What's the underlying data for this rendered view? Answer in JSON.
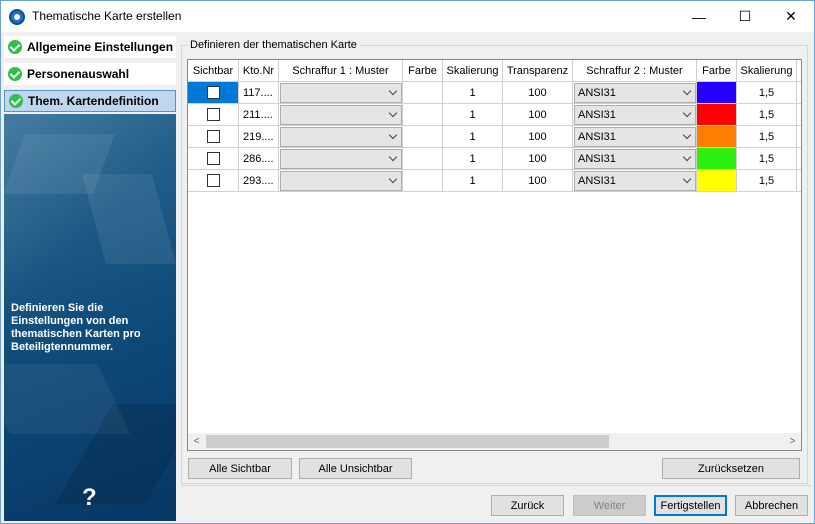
{
  "window": {
    "title": "Thematische Karte erstellen",
    "minimize_glyph": "—",
    "maximize_glyph": "☐",
    "close_glyph": "✕"
  },
  "sidebar": {
    "steps": [
      {
        "label": "Allgemeine Einstellungen",
        "icon": "check-icon",
        "active": false
      },
      {
        "label": "Personenauswahl",
        "icon": "check-icon",
        "active": false
      },
      {
        "label": "Them. Kartendefinition",
        "icon": "check-icon",
        "active": true
      }
    ],
    "description": "Definieren Sie die Einstellungen von den thematischen Karten pro Beteiligtennummer.",
    "help_glyph": "?"
  },
  "group": {
    "title": "Definieren der thematischen Karte"
  },
  "grid": {
    "columns": [
      "Sichtbar",
      "Kto.Nr",
      "Schraffur 1 : Muster",
      "Farbe",
      "Skalierung",
      "Transparenz",
      "Schraffur 2 : Muster",
      "Farbe",
      "Skalierung"
    ],
    "rows": [
      {
        "sichtbar": false,
        "kto": "117....",
        "schraffur1": "",
        "farbe1": "#ffffff",
        "skal1": "1",
        "transparenz": "100",
        "schraffur2": "ANSI31",
        "farbe2": "#2600ff",
        "skal2": "1,5"
      },
      {
        "sichtbar": false,
        "kto": "211....",
        "schraffur1": "",
        "farbe1": "#ffffff",
        "skal1": "1",
        "transparenz": "100",
        "schraffur2": "ANSI31",
        "farbe2": "#ff0000",
        "skal2": "1,5"
      },
      {
        "sichtbar": false,
        "kto": "219....",
        "schraffur1": "",
        "farbe1": "#ffffff",
        "skal1": "1",
        "transparenz": "100",
        "schraffur2": "ANSI31",
        "farbe2": "#ff8000",
        "skal2": "1,5"
      },
      {
        "sichtbar": false,
        "kto": "286....",
        "schraffur1": "",
        "farbe1": "#ffffff",
        "skal1": "1",
        "transparenz": "100",
        "schraffur2": "ANSI31",
        "farbe2": "#2ef00e",
        "skal2": "1,5"
      },
      {
        "sichtbar": false,
        "kto": "293....",
        "schraffur1": "",
        "farbe1": "#ffffff",
        "skal1": "1",
        "transparenz": "100",
        "schraffur2": "ANSI31",
        "farbe2": "#ffff00",
        "skal2": "1,5"
      }
    ]
  },
  "scroll": {
    "left_glyph": "<",
    "right_glyph": ">"
  },
  "buttons": {
    "alle_sichtbar": "Alle Sichtbar",
    "alle_unsichtbar": "Alle Unsichtbar",
    "zuruecksetzen": "Zurücksetzen",
    "zurueck": "Zurück",
    "weiter": "Weiter",
    "fertigstellen": "Fertigstellen",
    "abbrechen": "Abbrechen"
  }
}
